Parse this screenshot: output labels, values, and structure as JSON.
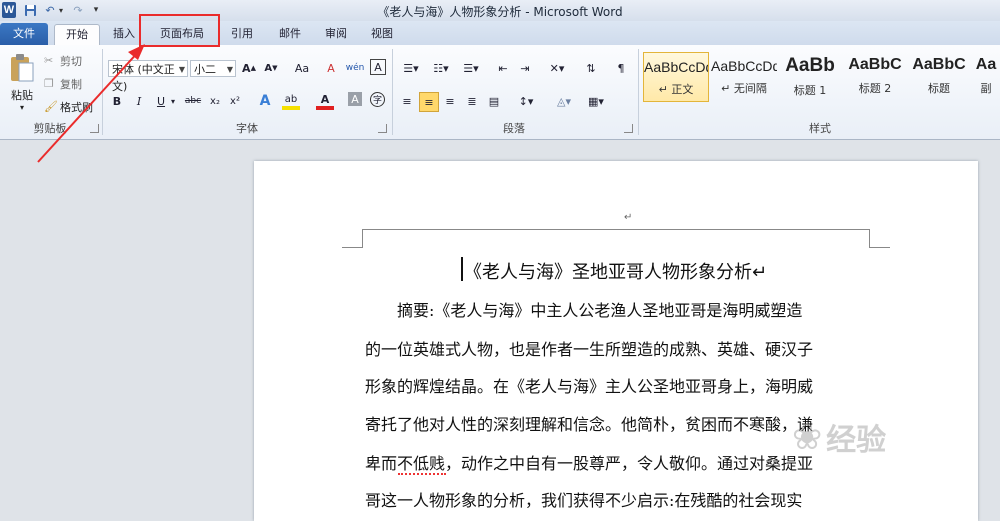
{
  "window": {
    "title": "《老人与海》人物形象分析 - Microsoft Word",
    "app_icon": "W",
    "quick_access": [
      "save-icon",
      "undo-icon",
      "redo-icon",
      "customize-icon"
    ]
  },
  "tabs": [
    {
      "label": "文件"
    },
    {
      "label": "开始"
    },
    {
      "label": "插入"
    },
    {
      "label": "页面布局"
    },
    {
      "label": "引用"
    },
    {
      "label": "邮件"
    },
    {
      "label": "审阅"
    },
    {
      "label": "视图"
    }
  ],
  "ribbon": {
    "clipboard": {
      "paste": "粘贴",
      "cut": "剪切",
      "copy": "复制",
      "format_painter": "格式刷",
      "label": "剪贴板"
    },
    "font": {
      "font_name": "宋体 (中文正文)",
      "font_size": "小二",
      "grow": "A",
      "shrink": "A",
      "change_case": "Aa",
      "clear": "A",
      "pinyin": "wén",
      "border": "A",
      "bold": "B",
      "italic": "I",
      "underline": "U",
      "strike": "abc",
      "subscript": "x₂",
      "superscript": "x²",
      "effects": "A",
      "highlight": "ab",
      "color": "A",
      "shade": "A",
      "enclose": "字",
      "label": "字体"
    },
    "paragraph": {
      "label": "段落"
    },
    "styles": {
      "label": "样式",
      "items": [
        {
          "sample": "AaBbCcDd",
          "name": "↵ 正文"
        },
        {
          "sample": "AaBbCcDd",
          "name": "↵ 无间隔"
        },
        {
          "sample": "AaBb",
          "name": "标题 1"
        },
        {
          "sample": "AaBbC",
          "name": "标题 2"
        },
        {
          "sample": "AaBbC",
          "name": "标题"
        },
        {
          "sample": "Aa",
          "name": "副"
        }
      ]
    }
  },
  "document": {
    "paragraph_mark": "↵",
    "title": "《老人与海》圣地亚哥人物形象分析↵",
    "lines": [
      "摘要:《老人与海》中主人公老渔人圣地亚哥是海明威塑造",
      "的一位英雄式人物，也是作者一生所塑造的成熟、英雄、硬汉子",
      "形象的辉煌结晶。在《老人与海》主人公圣地亚哥身上，海明威",
      "寄托了他对人性的深刻理解和信念。他简朴，贫困而不寒酸，谦",
      "卑而不低贱，动作之中自有一股尊严，令人敬仰。通过对桑提亚",
      "哥这一人物形象的分析，我们获得不少启示:在残酷的社会现实"
    ],
    "squiggle_word": "不低贱"
  },
  "watermark": {
    "text": "经验"
  },
  "colors": {
    "highlight_box": "#ea2b2b",
    "file_tab": "#2a5ea8"
  }
}
